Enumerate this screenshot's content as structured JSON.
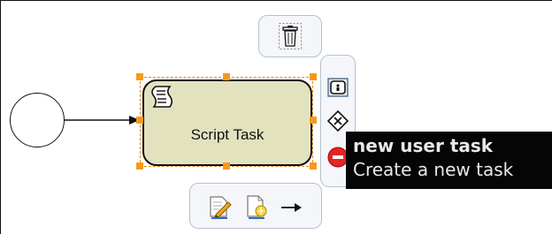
{
  "diagram": {
    "task": {
      "label": "Script Task",
      "type_icon": "script-icon"
    },
    "start_event": {
      "icon": "start-event-circle"
    }
  },
  "context_pad": {
    "top": [
      {
        "icon": "trash-icon",
        "action": "delete"
      }
    ],
    "right": [
      {
        "icon": "user-task-icon",
        "action": "new user task"
      },
      {
        "icon": "gateway-icon",
        "action": "new gateway"
      },
      {
        "icon": "end-event-icon",
        "action": "new end event"
      }
    ],
    "bottom": [
      {
        "icon": "edit-icon",
        "action": "edit"
      },
      {
        "icon": "change-type-icon",
        "action": "change type"
      },
      {
        "icon": "connect-arrow-icon",
        "action": "connect"
      }
    ]
  },
  "tooltip": {
    "title": "new user task",
    "description": "Create a new task"
  },
  "colors": {
    "task_fill": "#e3e2bf",
    "selection": "#e8891a",
    "handle": "#f59a19",
    "pad_bg": "#f4f6f9",
    "tooltip_bg": "#050505",
    "end_event_red": "#e02626"
  }
}
